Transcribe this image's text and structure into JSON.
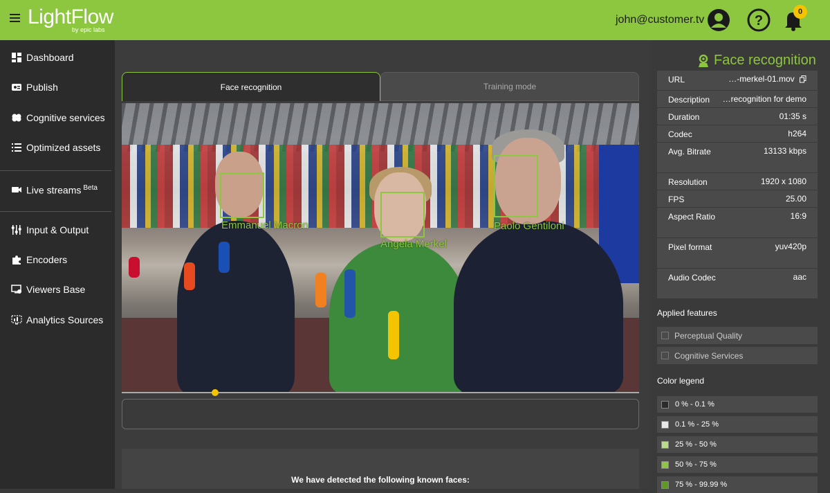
{
  "header": {
    "logo_main": "LightFlow",
    "logo_sub": "by epic labs",
    "user_email": "john@customer.tv",
    "notification_count": "0"
  },
  "sidebar": {
    "items": [
      {
        "label": "Dashboard",
        "icon": "dashboard-icon"
      },
      {
        "label": "Publish",
        "icon": "publish-icon"
      },
      {
        "label": "Cognitive services",
        "icon": "brain-icon"
      },
      {
        "label": "Optimized assets",
        "icon": "list-icon"
      },
      {
        "label": "Live streams",
        "sup": "Beta",
        "icon": "video-camera-icon"
      },
      {
        "label": "Input & Output",
        "icon": "sliders-icon"
      },
      {
        "label": "Encoders",
        "icon": "puzzle-icon"
      },
      {
        "label": "Viewers Base",
        "icon": "viewers-icon"
      },
      {
        "label": "Analytics Sources",
        "icon": "analytics-icon"
      }
    ]
  },
  "tabs": {
    "face_recognition": "Face recognition",
    "training_mode": "Training mode"
  },
  "video": {
    "faces": [
      {
        "name": "Emmanuel Macron"
      },
      {
        "name": "Angela Merkel"
      },
      {
        "name": "Paolo Gentiloni"
      }
    ],
    "progress_fraction": 0.18
  },
  "detected_text": "We have detected the following known faces:",
  "panel": {
    "title": "Face recognition",
    "properties": [
      {
        "label": "URL",
        "value": "…-merkel-01.mov"
      },
      {
        "label": "Description",
        "value": "…recognition for demo"
      },
      {
        "label": "Duration",
        "value": "01:35 s"
      },
      {
        "label": "Codec",
        "value": "h264"
      },
      {
        "label": "Avg. Bitrate",
        "value": "13133 kbps"
      },
      {
        "label": "Resolution",
        "value": "1920 x 1080"
      },
      {
        "label": "FPS",
        "value": "25.00"
      },
      {
        "label": "Aspect Ratio",
        "value": "16:9"
      },
      {
        "label": "Pixel format",
        "value": "yuv420p"
      },
      {
        "label": "Audio Codec",
        "value": "aac"
      }
    ],
    "applied_features_title": "Applied features",
    "features": [
      "Perceptual Quality",
      "Cognitive Services"
    ],
    "color_legend_title": "Color legend",
    "legend": [
      {
        "label": "0 % - 0.1 %",
        "color": "#2b2b2b"
      },
      {
        "label": "0.1 % - 25 %",
        "color": "#e8e8e8"
      },
      {
        "label": "25 % - 50 %",
        "color": "#b8dc8a"
      },
      {
        "label": "50 % - 75 %",
        "color": "#8dc63f"
      },
      {
        "label": "75 % - 99.99 %",
        "color": "#5e9a22"
      }
    ]
  },
  "colors": {
    "accent": "#8dc63f",
    "badge": "#f5c400"
  }
}
